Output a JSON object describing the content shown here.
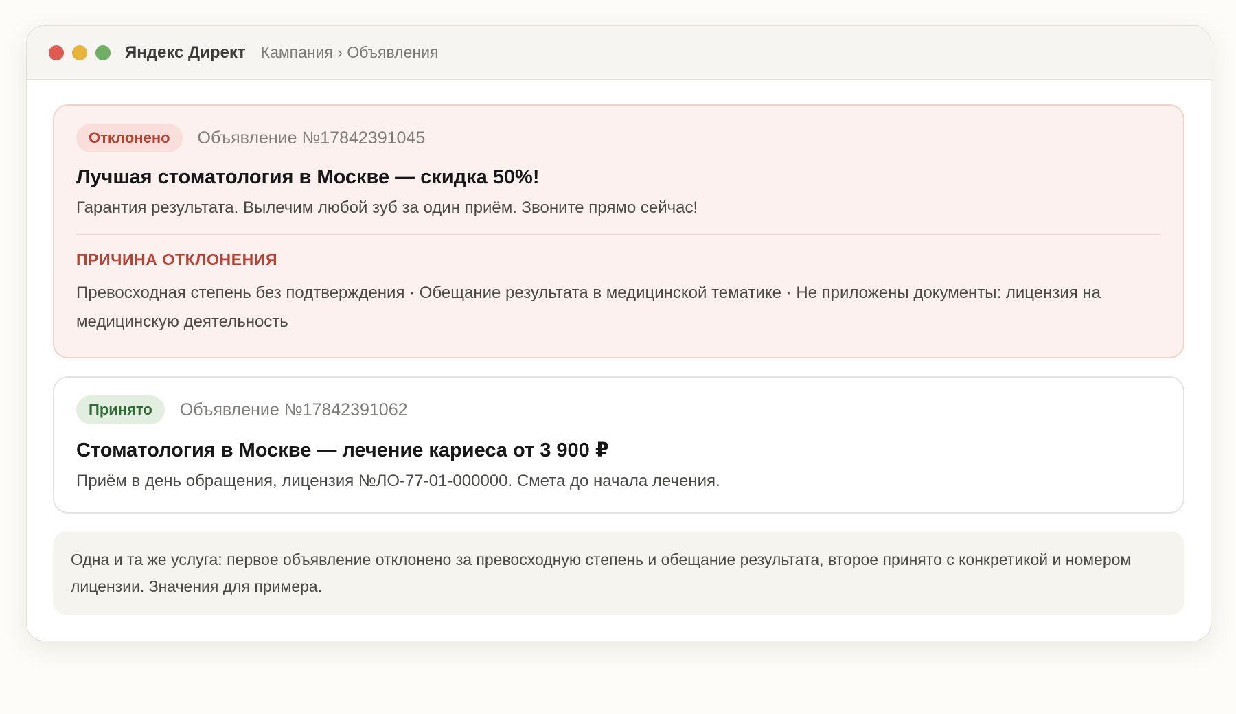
{
  "window": {
    "app_title": "Яндекс Директ",
    "breadcrumb": "Кампания › Объявления"
  },
  "ads": [
    {
      "status": "Отклонено",
      "number": "Объявление №17842391045",
      "title": "Лучшая стоматология в Москве — скидка 50%!",
      "text": "Гарантия результата. Вылечим любой зуб за один приём. Звоните прямо сейчас!",
      "reason_label": "ПРИЧИНА ОТКЛОНЕНИЯ",
      "reason_text": "Превосходная степень без подтверждения · Обещание результата в медицинской тематике · Не приложены документы: лицензия на медицинскую деятельность"
    },
    {
      "status": "Принято",
      "number": "Объявление №17842391062",
      "title": "Стоматология в Москве — лечение кариеса от 3 900 ₽",
      "text": "Приём в день обращения, лицензия №ЛО-77-01-000000. Смета до начала лечения."
    }
  ],
  "note": "Одна и та же услуга: первое объявление отклонено за превосходную степень и обещание результата, второе принято с конкретикой и номером лицензии. Значения для примера.",
  "colors": {
    "rejected_accent": "#b64232",
    "accepted_accent": "#2f6a35",
    "rejected_card_bg": "#fdf1ef"
  }
}
